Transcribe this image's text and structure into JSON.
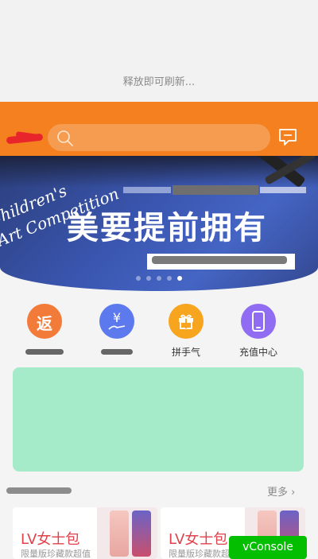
{
  "pull_refresh": {
    "text": "释放即可刷新..."
  },
  "header": {
    "search_icon": "search-icon",
    "message_icon": "message-icon",
    "accent": "#f4801f"
  },
  "banner": {
    "art_line1": "Children's",
    "art_line2": "Art Competition",
    "title": "美要提前拥有",
    "dots": 5,
    "active_dot": 5
  },
  "quick_icons": [
    {
      "icon": "return-icon",
      "glyph": "返",
      "label": "",
      "color": "#f27b3a"
    },
    {
      "icon": "yuan-hand-icon",
      "glyph": "¥",
      "label": "",
      "color": "#5c79ee"
    },
    {
      "icon": "gift-icon",
      "glyph": "",
      "label": "拼手气",
      "color": "#f7a41f"
    },
    {
      "icon": "phone-icon",
      "glyph": "",
      "label": "充值中心",
      "color": "#8f6cf2"
    }
  ],
  "section": {
    "more_label": "更多"
  },
  "products": [
    {
      "title": "LV女士包",
      "subtitle": "限量版珍藏款超值"
    },
    {
      "title": "LV女士包",
      "subtitle": "限量版珍藏款超值"
    }
  ],
  "vconsole": {
    "label": "vConsole",
    "color": "#04be02"
  }
}
